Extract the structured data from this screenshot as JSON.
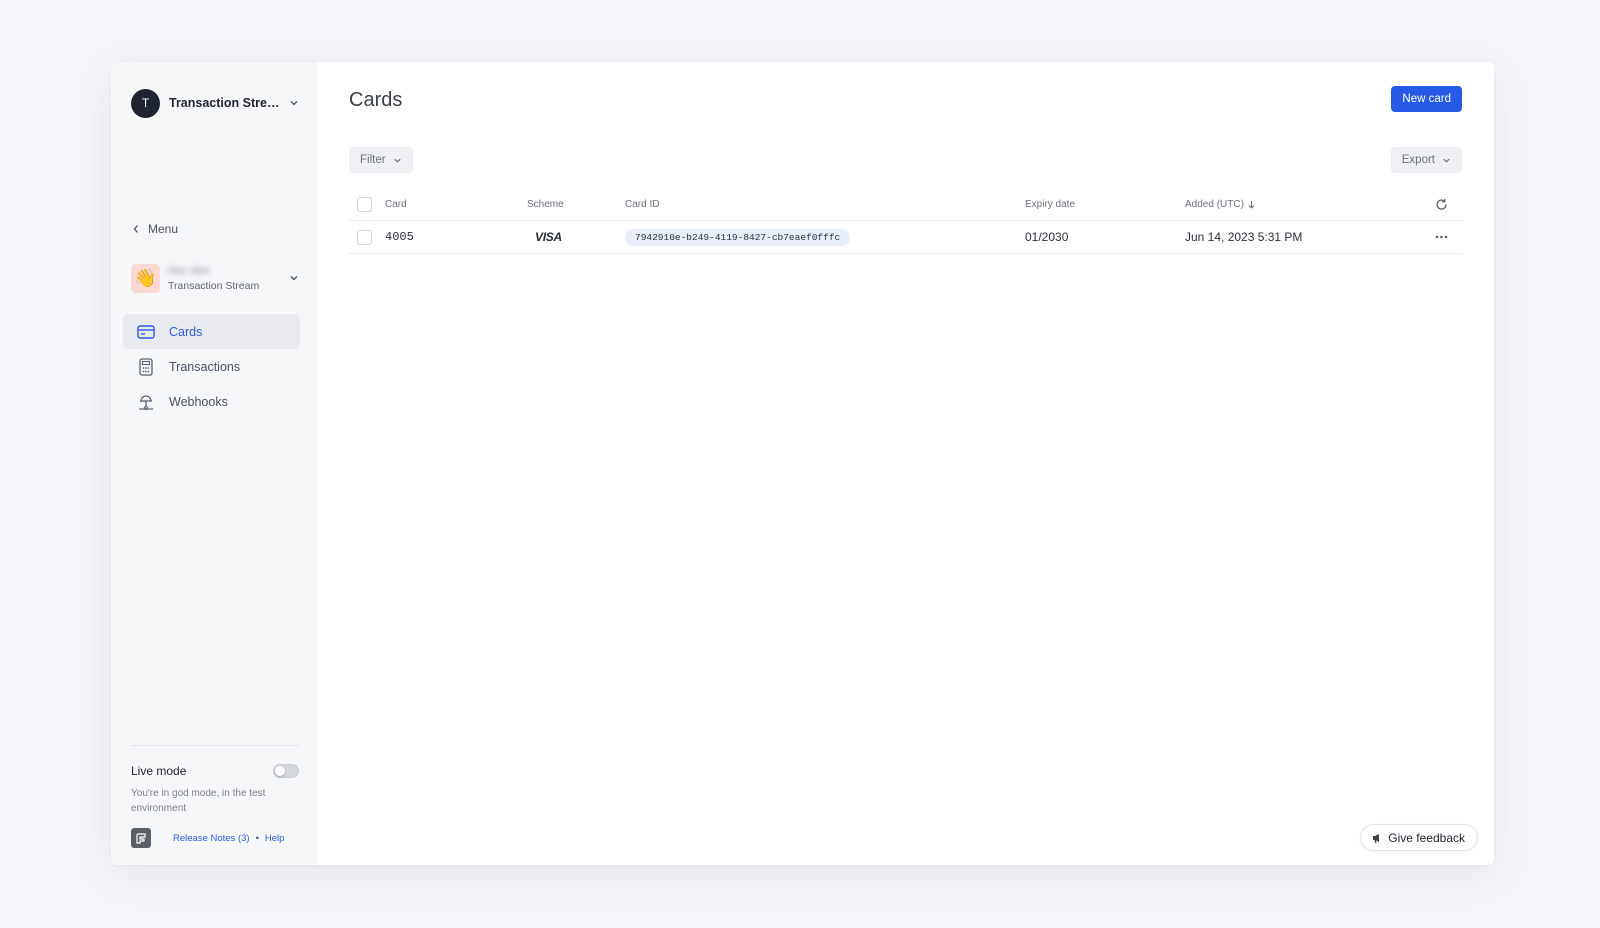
{
  "workspace": {
    "initial": "T",
    "name": "Transaction Strea..."
  },
  "menu_back": "Menu",
  "account": {
    "emoji": "👋",
    "user": "Our dev",
    "subtitle": "Transaction Stream"
  },
  "nav": [
    {
      "label": "Cards",
      "icon": "card-icon",
      "active": true
    },
    {
      "label": "Transactions",
      "icon": "calculator-icon",
      "active": false
    },
    {
      "label": "Webhooks",
      "icon": "webhook-icon",
      "active": false
    }
  ],
  "live_mode": {
    "label": "Live mode",
    "enabled": false,
    "description": "You're in god mode, in the test environment"
  },
  "footer": {
    "release_notes": "Release Notes (3)",
    "separator": "•",
    "help": "Help"
  },
  "page": {
    "title": "Cards",
    "new_card_label": "New card",
    "filter_label": "Filter",
    "export_label": "Export"
  },
  "table": {
    "columns": [
      "Card",
      "Scheme",
      "Card ID",
      "Expiry date",
      "Added (UTC)"
    ],
    "rows": [
      {
        "card": "4005",
        "scheme": "VISA",
        "card_id": "7942910e-b249-4119-8427-cb7eaef0fffc",
        "expiry": "01/2030",
        "added": "Jun 14, 2023 5:31 PM"
      }
    ]
  },
  "feedback_label": "Give feedback",
  "colors": {
    "accent": "#2659e6",
    "sidebar_bg": "#f6f7f9",
    "active_nav_bg": "#e8eaef"
  }
}
